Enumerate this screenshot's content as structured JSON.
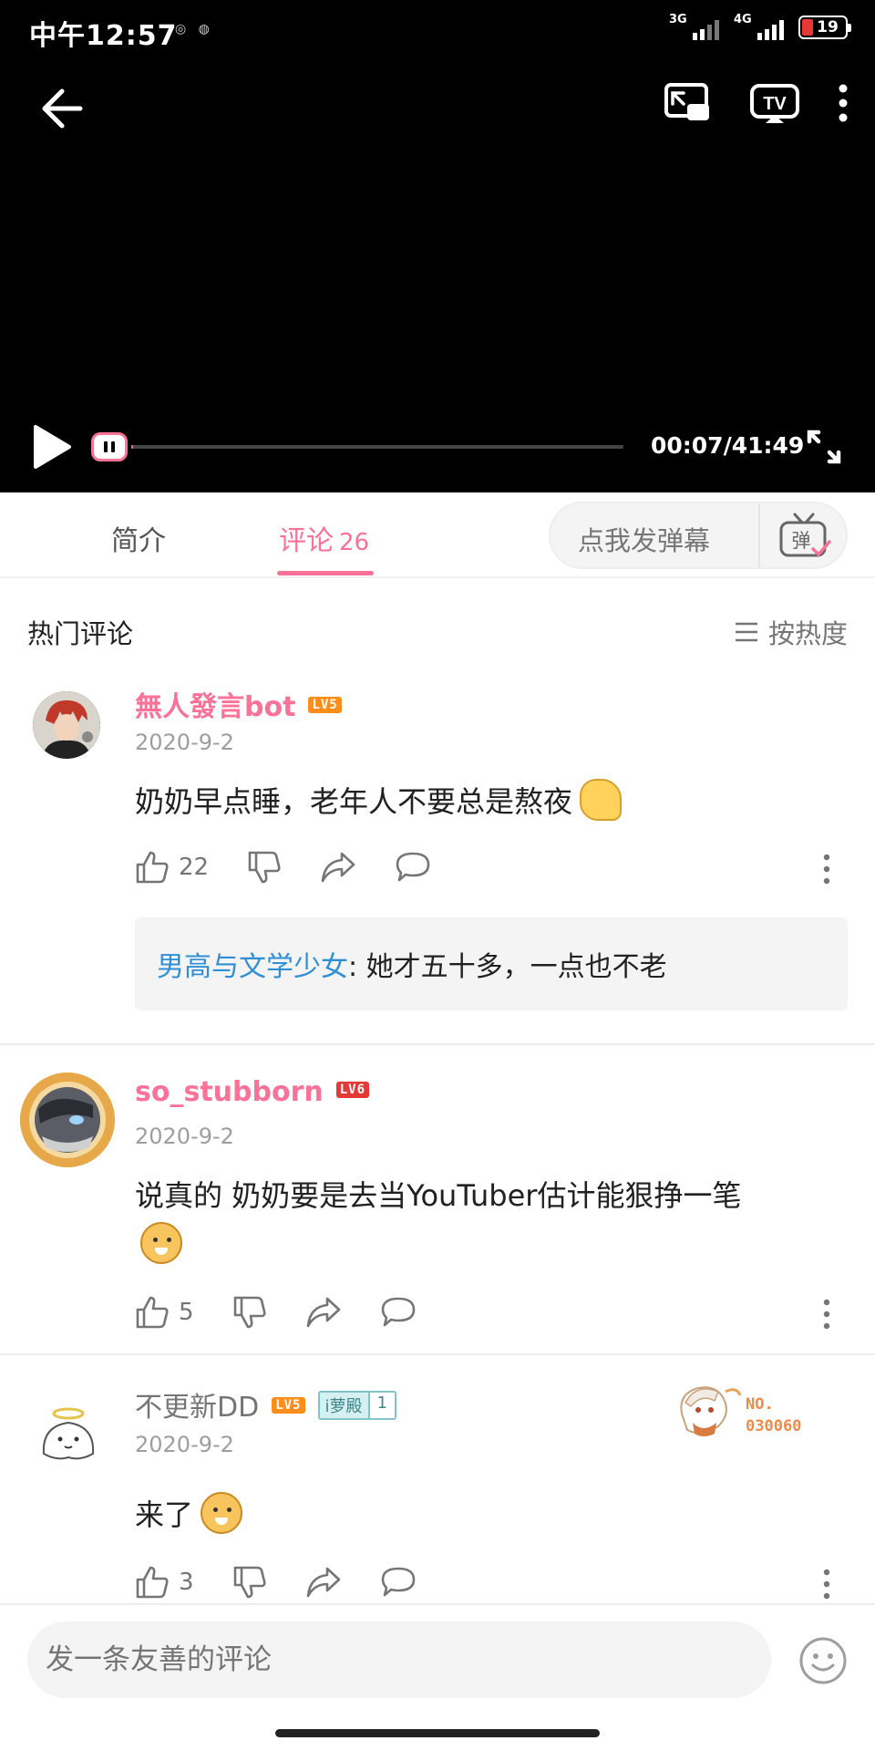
{
  "status_bar": {
    "time": "中午12:57",
    "net1": "3G",
    "net2": "4G",
    "battery": "19"
  },
  "player": {
    "time": "00:07/41:49",
    "progress": 0.003
  },
  "tabs": {
    "intro": "简介",
    "comments": "评论",
    "comment_count": "26",
    "danmaku_placeholder": "点我发弹幕",
    "danmaku_icon_text": "弹"
  },
  "section": {
    "title": "热门评论",
    "sort": "按热度"
  },
  "comments": [
    {
      "user": "無人發言bot",
      "level": "LV5",
      "date": "2020-9-2",
      "text": "奶奶早点睡，老年人不要总是熬夜",
      "likes": "22",
      "reply": {
        "user": "男高与文学少女",
        "text": ": 她才五十多，一点也不老"
      }
    },
    {
      "user": "so_stubborn",
      "level": "LV6",
      "date": "2020-9-2",
      "text": "说真的 奶奶要是去当YouTuber估计能狠挣一笔",
      "likes": "5"
    },
    {
      "user": "不更新DD",
      "level": "LV5",
      "medal_name": "i萝殿",
      "medal_level": "1",
      "date": "2020-9-2",
      "text": "来了",
      "likes": "3",
      "badge_line1": "NO.",
      "badge_line2": "030060"
    }
  ],
  "bottom": {
    "placeholder": "发一条友善的评论"
  }
}
